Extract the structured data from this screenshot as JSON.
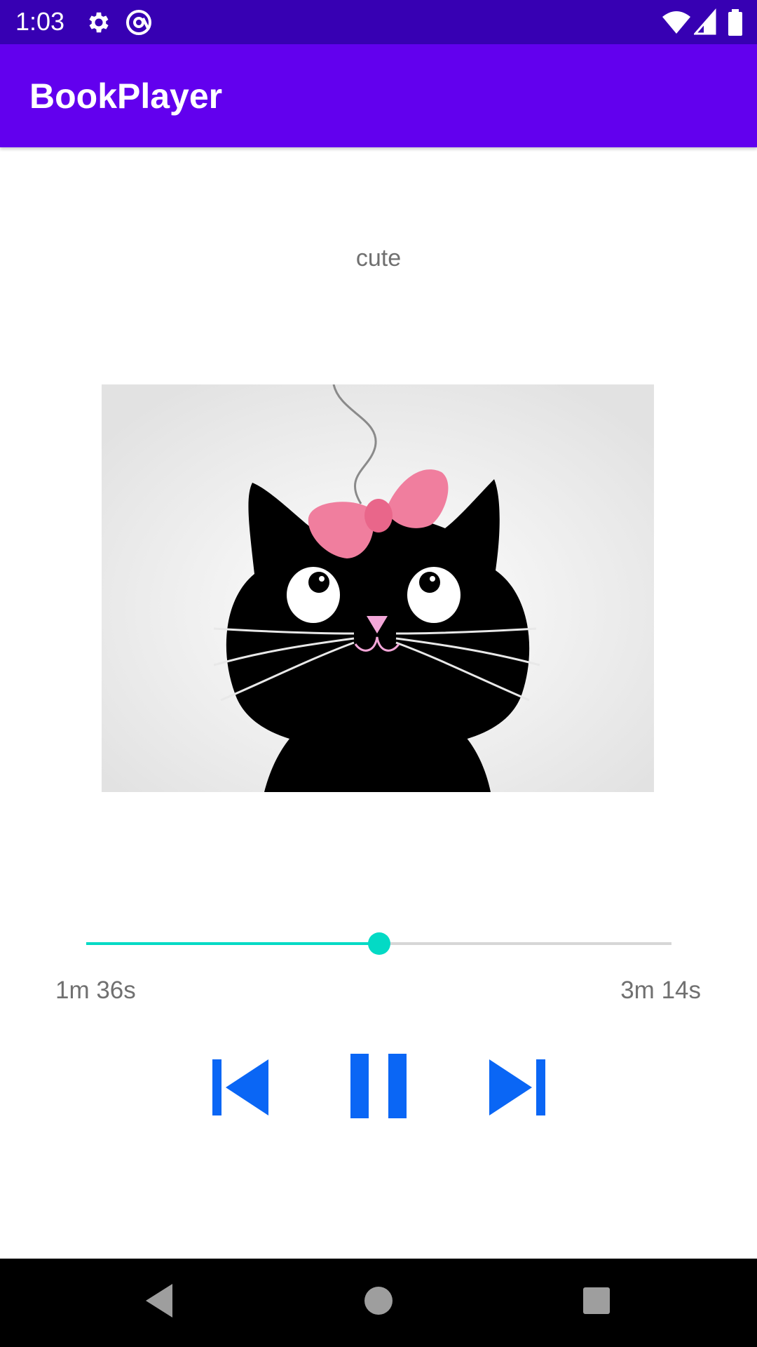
{
  "status_bar": {
    "time": "1:03",
    "icons": [
      "gear-icon",
      "at-sign-icon",
      "wifi-icon",
      "signal-icon",
      "battery-icon"
    ]
  },
  "app_bar": {
    "title": "BookPlayer"
  },
  "player": {
    "book_title": "cute",
    "cover_icon": "black-cat-with-pink-bow-image",
    "progress_fraction": 0.5,
    "elapsed": "1m 36s",
    "total": "3m 14s",
    "controls": [
      "skip-previous-icon",
      "pause-icon",
      "skip-next-icon"
    ]
  },
  "nav_bar": {
    "buttons": [
      "back-icon",
      "home-icon",
      "recents-icon"
    ]
  },
  "colors": {
    "status_bar": "#3700b3",
    "app_bar": "#6200ee",
    "seek_accent": "#03dac5",
    "control_blue": "#0a66f5",
    "text_gray": "#707070"
  }
}
